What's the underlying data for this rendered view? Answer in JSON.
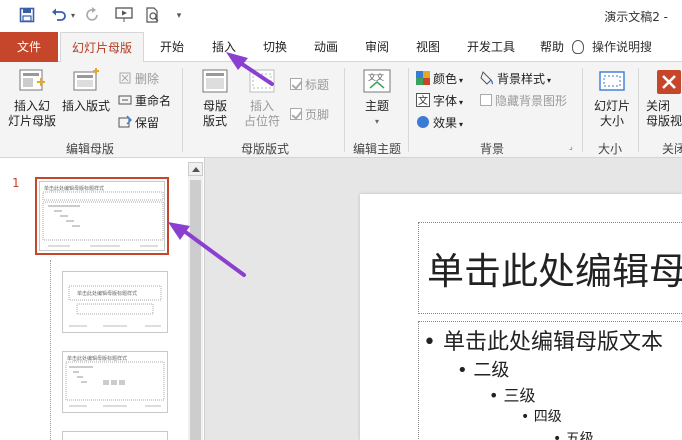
{
  "titlebar": {
    "save_icon": "save-icon",
    "undo_icon": "undo-icon",
    "redo_icon": "redo-icon",
    "present_icon": "present-from-start-icon",
    "preview_icon": "print-preview-icon",
    "doc_title": "演示文稿2 -"
  },
  "tabs": {
    "file": "文件",
    "slide_master": "幻灯片母版",
    "home": "开始",
    "insert": "插入",
    "transitions": "切换",
    "animations": "动画",
    "review": "审阅",
    "view": "视图",
    "developer": "开发工具",
    "help": "帮助",
    "tell_me": "操作说明搜"
  },
  "ribbon": {
    "edit_master": {
      "insert_slide_master": "插入幻\n灯片母版",
      "insert_layout": "插入版式",
      "delete": "删除",
      "rename": "重命名",
      "preserve": "保留",
      "group_label": "编辑母版"
    },
    "master_layout": {
      "master_layout_btn": "母版\n版式",
      "insert_placeholder": "插入\n占位符",
      "title_chk": "标题",
      "footer_chk": "页脚",
      "group_label": "母版版式"
    },
    "edit_theme": {
      "themes": "主题",
      "group_label": "编辑主题"
    },
    "background": {
      "colors": "颜色",
      "fonts": "字体",
      "effects": "效果",
      "bg_styles": "背景样式",
      "hide_bg": "隐藏背景图形",
      "group_label": "背景"
    },
    "size": {
      "slide_size": "幻灯片\n大小",
      "group_label": "大小"
    },
    "close": {
      "close_btn": "关闭\n母版视",
      "group_label": "关闭"
    }
  },
  "thumbnails": {
    "selected_number": "1",
    "thumb1_title": "单击此处编辑母版标题样式",
    "thumb2_title": "单击此处编辑母版标题样式",
    "thumb3_title": "单击此处编辑母版标题样式"
  },
  "slide": {
    "title": "单击此处编辑母",
    "body_l1": "• 单击此处编辑母版文本",
    "body_l2": "• 二级",
    "body_l3": "• 三级",
    "body_l4": "• 四级",
    "body_l5": "• 五级"
  },
  "colors": {
    "accent": "#c6462b",
    "arrow": "#8a3fd1"
  }
}
